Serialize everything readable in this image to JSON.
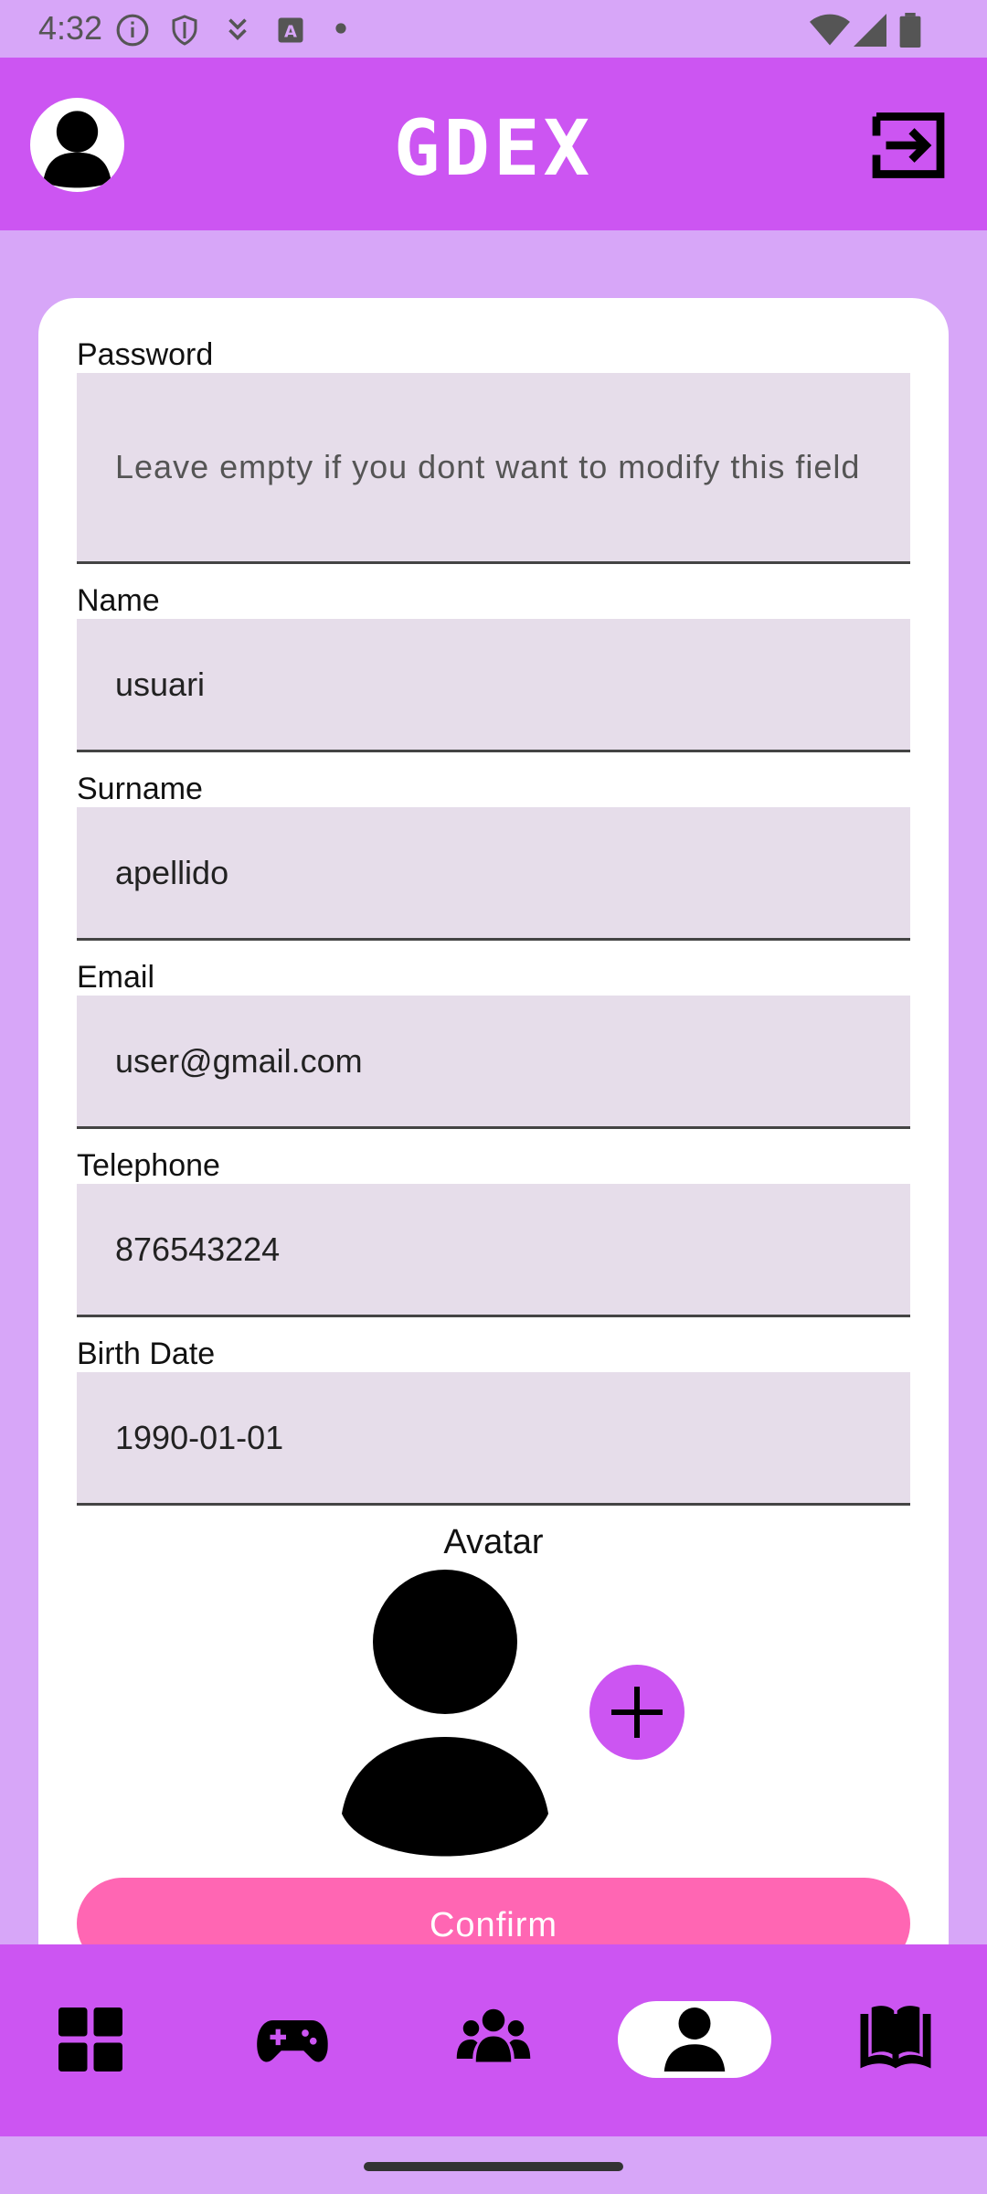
{
  "status_bar": {
    "time": "4:32",
    "icons_left": [
      "info-icon",
      "shield-icon",
      "download-icon",
      "font-icon",
      "dot-icon"
    ],
    "icons_right": [
      "wifi-icon",
      "signal-icon",
      "battery-icon"
    ]
  },
  "app_bar": {
    "title": "GDEX",
    "left_icon": "profile-avatar-icon",
    "right_icon": "logout-icon"
  },
  "form": {
    "password": {
      "label": "Password",
      "placeholder": "Leave empty if you dont want to modify this field",
      "value": ""
    },
    "name": {
      "label": "Name",
      "value": "usuari"
    },
    "surname": {
      "label": "Surname",
      "value": "apellido"
    },
    "email": {
      "label": "Email",
      "value": "user@gmail.com"
    },
    "telephone": {
      "label": "Telephone",
      "value": "876543224"
    },
    "birth_date": {
      "label": "Birth Date",
      "value": "1990-01-01"
    },
    "avatar": {
      "label": "Avatar"
    },
    "confirm_label": "Confirm"
  },
  "bottom_nav": {
    "items": [
      {
        "icon": "dashboard-icon",
        "active": false
      },
      {
        "icon": "gamepad-icon",
        "active": false
      },
      {
        "icon": "group-icon",
        "active": false
      },
      {
        "icon": "person-icon",
        "active": true
      },
      {
        "icon": "book-icon",
        "active": false
      }
    ]
  },
  "colors": {
    "primary": "#CC55F2",
    "background": "#D7A6F8",
    "field_bg": "#E6DDEA",
    "confirm": "#FF66B3"
  }
}
